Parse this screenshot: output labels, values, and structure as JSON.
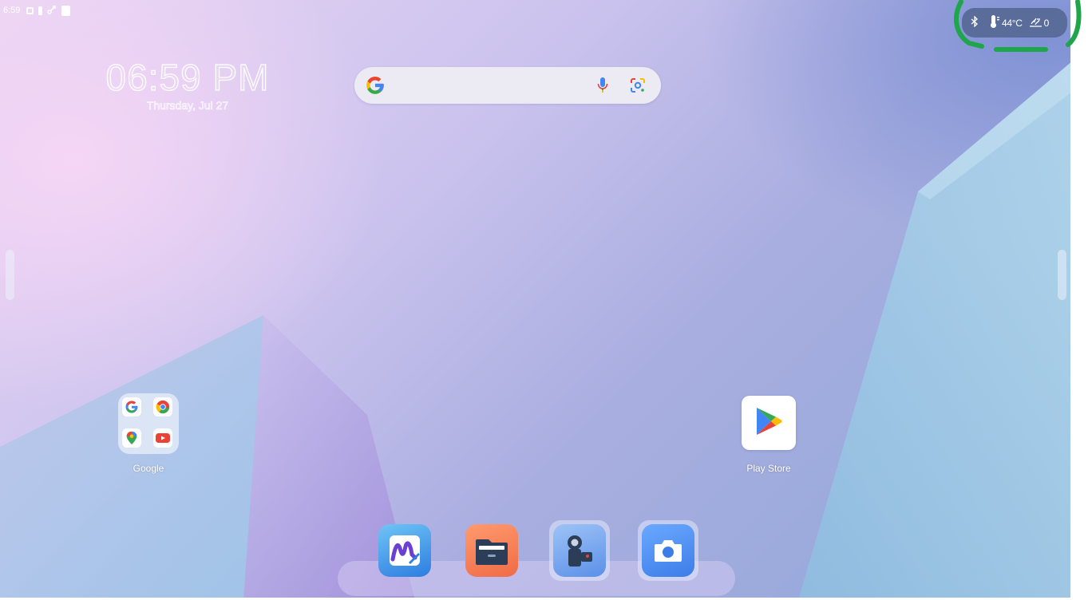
{
  "status_bar": {
    "time": "6:59",
    "icons": [
      "screenshot-icon",
      "key-icon",
      "usb-icon",
      "sd-card-icon"
    ]
  },
  "status_pill": {
    "icons": [
      "bluetooth-icon",
      "thermometer-icon",
      "network-speed-icon"
    ],
    "temperature": "44°C",
    "speed_value": "0",
    "highlight_color": "#1fa54a"
  },
  "clock": {
    "time": "06:59 PM",
    "date": "Thursday, Jul 27"
  },
  "search": {
    "logo": "google-g-icon",
    "icons": [
      "mic-icon",
      "lens-icon"
    ]
  },
  "home": {
    "folder": {
      "label": "Google",
      "apps": [
        "google-icon",
        "chrome-icon",
        "maps-icon",
        "youtube-icon"
      ]
    },
    "play_store": {
      "label": "Play Store"
    }
  },
  "dock": {
    "apps": [
      "whiteboard-app",
      "file-manager-app",
      "camera-app",
      "screenshot-app"
    ]
  },
  "colors": {
    "accent_pill": "#5a6c99",
    "highlight": "#1fa54a",
    "google_blue": "#4285f4",
    "google_red": "#ea4335",
    "google_yellow": "#fbbc05",
    "google_green": "#34a853"
  }
}
